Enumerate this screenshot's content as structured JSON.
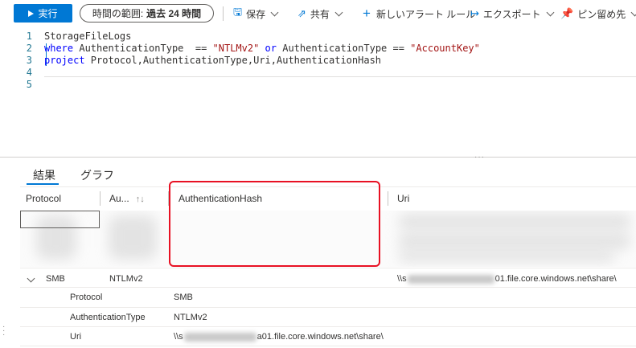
{
  "toolbar": {
    "run_label": "実行",
    "time_range_label": "時間の範囲:",
    "time_range_value": "過去 24 時間",
    "save_label": "保存",
    "share_label": "共有",
    "new_alert_label": "新しいアラート ルール",
    "export_label": "エクスポート",
    "pin_label": "ピン留め先"
  },
  "editor": {
    "line_numbers": [
      "1",
      "2",
      "3",
      "4",
      "5"
    ],
    "line1": "StorageFileLogs",
    "line2_kw": "where",
    "line2_field": " AuthenticationType  == ",
    "line2_str1": "\"NTLMv2\"",
    "line2_or": " or ",
    "line2_field2": "AuthenticationType == ",
    "line2_str2": "\"AccountKey\"",
    "line3_kw": "project",
    "line3_rest": " Protocol,AuthenticationType,Uri,AuthenticationHash"
  },
  "results": {
    "tab_results": "結果",
    "tab_chart": "グラフ",
    "columns": [
      "Protocol",
      "Au...",
      "AuthenticationHash",
      "Uri"
    ],
    "row": {
      "protocol": "SMB",
      "auth_type": "NTLMv2",
      "uri_prefix": "\\\\s",
      "uri_suffix": "01.file.core.windows.net\\share\\"
    },
    "details": [
      {
        "key": "Protocol",
        "value": "SMB"
      },
      {
        "key": "AuthenticationType",
        "value": "NTLMv2"
      },
      {
        "key": "Uri",
        "value_prefix": "\\\\s",
        "value_suffix": "a01.file.core.windows.net\\share\\"
      }
    ]
  },
  "colors": {
    "accent": "#0078d4",
    "highlight": "#e81123"
  }
}
